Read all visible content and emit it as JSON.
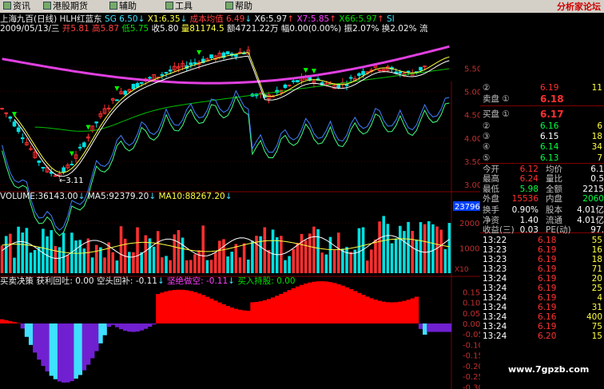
{
  "menu": {
    "items": [
      "资讯",
      "港股期货",
      "辅助",
      "工具",
      "帮助"
    ],
    "right_text": "分析家论坛"
  },
  "header": {
    "line1": [
      {
        "t": "上海九百(日线)",
        "c": "w"
      },
      {
        "t": " HLH红蓝东 ",
        "c": "w"
      },
      {
        "t": "SG 6.50",
        "c": "c"
      },
      {
        "t": "↓ ",
        "c": "c"
      },
      {
        "t": "X1:6.35",
        "c": "y"
      },
      {
        "t": "↓ ",
        "c": "c"
      },
      {
        "t": "成本均值 6.49",
        "c": "r"
      },
      {
        "t": "↓ ",
        "c": "c"
      },
      {
        "t": "X6:5.97",
        "c": "w"
      },
      {
        "t": "↑ ",
        "c": "r"
      },
      {
        "t": "X7:5.85",
        "c": "m"
      },
      {
        "t": "↑ ",
        "c": "r"
      },
      {
        "t": "X66:5.97",
        "c": "g"
      },
      {
        "t": "↑ ",
        "c": "r"
      },
      {
        "t": "SI",
        "c": "c"
      }
    ],
    "line2": [
      {
        "t": "2009/05/13/三 ",
        "c": "w"
      },
      {
        "t": "开5.81 ",
        "c": "r"
      },
      {
        "t": "高5.87 ",
        "c": "r"
      },
      {
        "t": "低5.75 ",
        "c": "g"
      },
      {
        "t": "收5.80 ",
        "c": "w"
      },
      {
        "t": "量81174.5 ",
        "c": "y"
      },
      {
        "t": "额4721.22万 ",
        "c": "w"
      },
      {
        "t": "幅0.00(0.00%) ",
        "c": "w"
      },
      {
        "t": "振2.07% ",
        "c": "w"
      },
      {
        "t": "换2.02% ",
        "c": "w"
      },
      {
        "t": "流",
        "c": "w"
      }
    ]
  },
  "price_chart": {
    "y_ticks": [
      "5.50",
      "5.00",
      "4.50",
      "4.00",
      "3.50",
      "3.00"
    ],
    "low_label": "←3.11",
    "grid": true
  },
  "volume_panel": {
    "legend": [
      {
        "t": "VOLUME:36143.00",
        "c": "w"
      },
      {
        "t": "↓  ",
        "c": "c"
      },
      {
        "t": "MA5:92379.20",
        "c": "w"
      },
      {
        "t": "↓  ",
        "c": "c"
      },
      {
        "t": "MA10:88267.20",
        "c": "y"
      },
      {
        "t": "↓",
        "c": "c"
      }
    ],
    "y_ticks": [
      "20000",
      "10000"
    ],
    "current_badge": "23796",
    "unit": "X10"
  },
  "indicator_panel": {
    "legend": [
      {
        "t": "买卖决策 ",
        "c": "w"
      },
      {
        "t": "获利回吐: 0.00 ",
        "c": "w"
      },
      {
        "t": "空头回补: -0.11",
        "c": "w"
      },
      {
        "t": "↓  ",
        "c": "c"
      },
      {
        "t": "坚绝做空: -0.11",
        "c": "m"
      },
      {
        "t": "↓  ",
        "c": "c"
      },
      {
        "t": "买入持股: 0.00",
        "c": "g"
      }
    ],
    "y_ticks": [
      "0.15",
      "0.10",
      "0.05",
      "0.00",
      "-0.05",
      "-0.10",
      "-0.15",
      "-0.20",
      "-0.25",
      "-0.30"
    ]
  },
  "quote": {
    "order_book_top": [
      {
        "label": "②",
        "price": "6.19",
        "vol": "11"
      },
      {
        "label": "卖盘 ①",
        "price": "6.18",
        "vol": ""
      },
      {
        "label": "买盘 ①",
        "price": "6.17",
        "vol": ""
      },
      {
        "label": "②",
        "price": "6.16",
        "vol": "6"
      },
      {
        "label": "③",
        "price": "6.15",
        "vol": "18"
      },
      {
        "label": "④",
        "price": "6.14",
        "vol": "34"
      },
      {
        "label": "⑤",
        "price": "6.13",
        "vol": "7"
      }
    ],
    "stats": [
      [
        "今开",
        "6.12",
        "均价",
        "6.1"
      ],
      [
        "最高",
        "6.24",
        "量比",
        "0.5"
      ],
      [
        "最低",
        "5.98",
        "全额",
        "2215"
      ],
      [
        "外盘",
        "15536",
        "内盘",
        "2060"
      ],
      [
        "换手",
        "0.90%",
        "股本",
        "4.01亿"
      ],
      [
        "净资",
        "1.40",
        "流通",
        "4.01亿"
      ],
      [
        "收益(三)",
        "0.03",
        "PE(动)",
        "97."
      ]
    ],
    "ticks": [
      [
        "13:22",
        "6.18",
        "55"
      ],
      [
        "13:23",
        "6.19",
        "16"
      ],
      [
        "13:23",
        "6.19",
        "18"
      ],
      [
        "13:23",
        "6.19",
        "71"
      ],
      [
        "13:24",
        "6.19",
        "20"
      ],
      [
        "13:24",
        "6.19",
        "25"
      ],
      [
        "13:24",
        "6.19",
        "4"
      ],
      [
        "13:24",
        "6.19",
        "31"
      ],
      [
        "13:24",
        "6.16",
        "400"
      ],
      [
        "13:24",
        "6.19",
        "75"
      ],
      [
        "13:24",
        "6.20",
        "15"
      ]
    ]
  },
  "watermark": "www.7gpzb.com",
  "colors": {
    "up": "#ff3030",
    "down": "#00e0e0",
    "ma_long": "#e040e0",
    "ma_mid": "#00c000",
    "bear_bar": "#7020d0",
    "bull_bar": "#ff0000"
  }
}
